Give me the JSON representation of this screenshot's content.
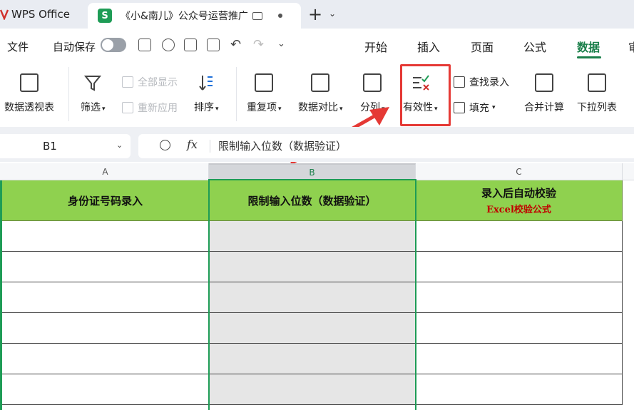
{
  "app": {
    "title": "WPS Office",
    "accent": "#1a7f4a"
  },
  "document_tab": {
    "icon_letter": "S",
    "title": "《小&南儿》公众号运营推广"
  },
  "menu": {
    "file": "文件",
    "autosave": "自动保存",
    "tabs": [
      "开始",
      "插入",
      "页面",
      "公式",
      "数据",
      "审"
    ],
    "active_tab": "数据"
  },
  "ribbon": {
    "pivot": "数据透视表",
    "filter": "筛选",
    "show_all": "全部显示",
    "reapply": "重新应用",
    "sort": "排序",
    "duplicates": "重复项",
    "compare": "数据对比",
    "split": "分列",
    "validity": "有效性",
    "lookup_entry": "查找录入",
    "fill": "填充",
    "consolidate": "合并计算",
    "dropdown_list": "下拉列表"
  },
  "formula_bar": {
    "cell_ref": "B1",
    "fx": "fx",
    "value": "限制输入位数（数据验证）"
  },
  "sheet": {
    "columns": [
      "A",
      "B",
      "C"
    ],
    "header_row": {
      "a": "身份证号码录入",
      "b": "限制输入位数（数据验证）",
      "c_line1": "录入后自动校验",
      "c_line2": "Excel校验公式"
    }
  }
}
